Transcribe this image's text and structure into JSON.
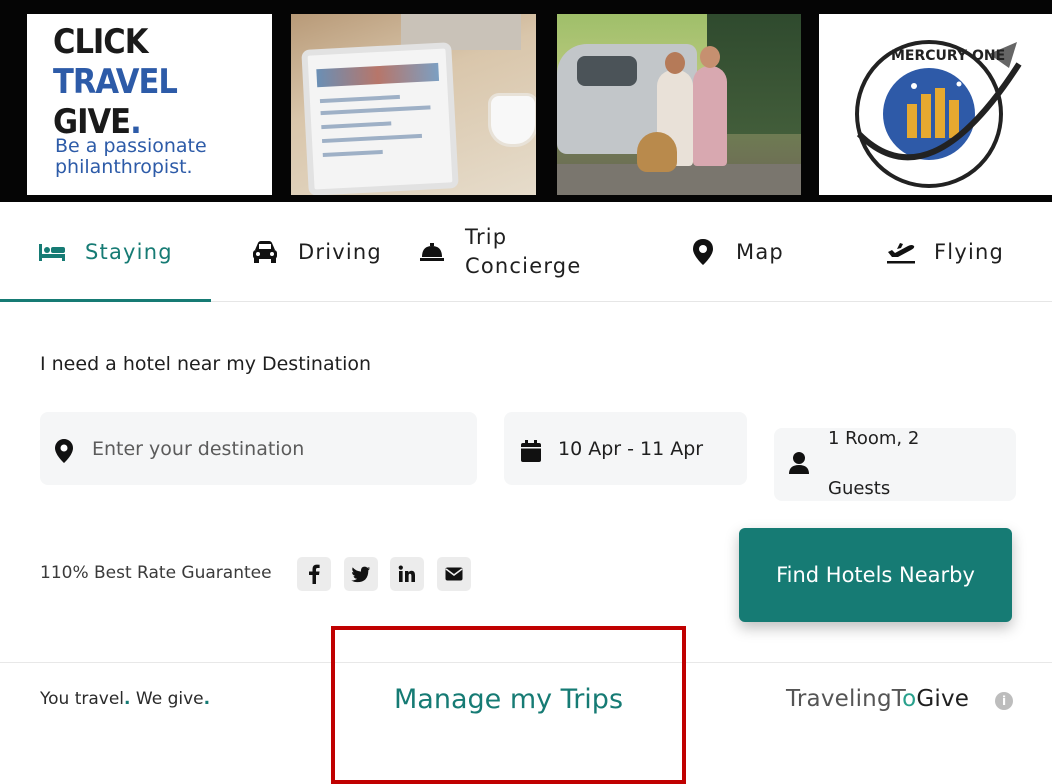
{
  "banner": {
    "tile1": {
      "line1": "CLICK",
      "line2": "TRAVEL",
      "line3": "GIVE",
      "line3_dot": ".",
      "subtitle": "Be a passionate philanthropist."
    },
    "tile4": {
      "logo_text": "MERCURY ONE"
    }
  },
  "tabs": [
    {
      "label": "Staying",
      "icon": "bed-icon",
      "active": true
    },
    {
      "label": "Driving",
      "icon": "car-icon",
      "active": false
    },
    {
      "label": "Trip Concierge",
      "icon": "concierge-bell-icon",
      "active": false
    },
    {
      "label": "Map",
      "icon": "map-pin-icon",
      "active": false
    },
    {
      "label": "Flying",
      "icon": "plane-icon",
      "active": false
    }
  ],
  "form": {
    "heading": "I need a hotel near my Destination",
    "destination": {
      "placeholder": "Enter your destination",
      "value": ""
    },
    "dates": "10 Apr - 11 Apr",
    "guests": "1 Room, 2 Guests"
  },
  "rate_guarantee": "110% Best Rate Guarantee",
  "share_icons": [
    "facebook-icon",
    "twitter-icon",
    "linkedin-icon",
    "mail-icon"
  ],
  "find_button": "Find Hotels Nearby",
  "footer": {
    "slogan_part1": "You travel",
    "slogan_part2": "We give",
    "manage_trips": "Manage my Trips",
    "brand_part1": "TravelingT",
    "brand_part2": "Give"
  },
  "colors": {
    "accent": "#167b74",
    "highlight_border": "#c00000"
  }
}
